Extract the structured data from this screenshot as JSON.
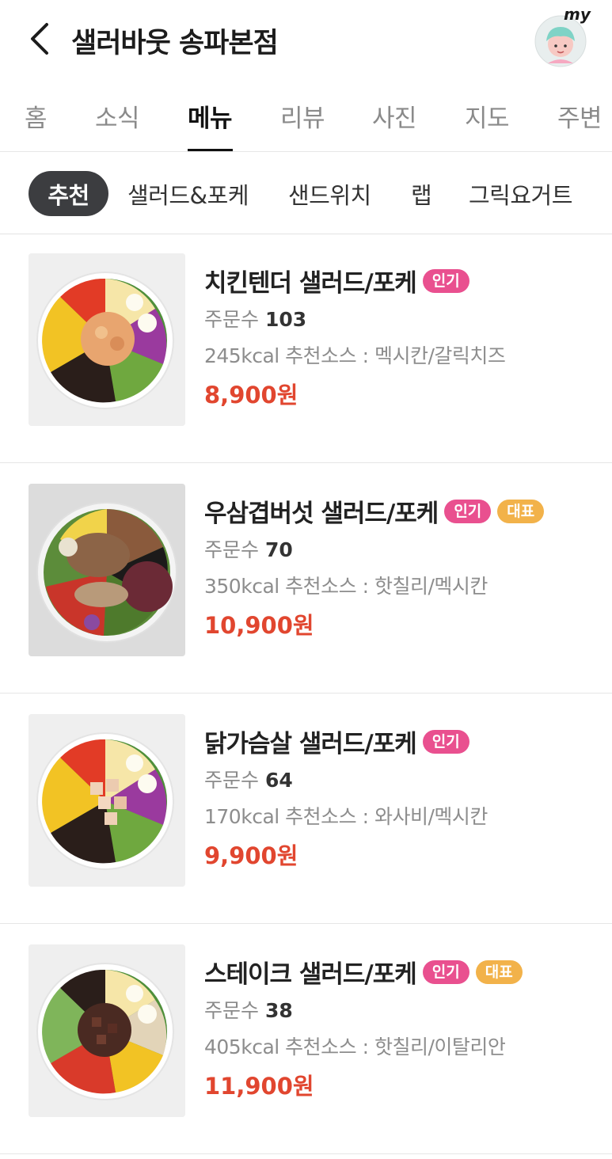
{
  "header": {
    "title": "샐러바웃 송파본점",
    "my_label": "my"
  },
  "tabs": [
    {
      "label": "홈"
    },
    {
      "label": "소식"
    },
    {
      "label": "메뉴",
      "active": true
    },
    {
      "label": "리뷰"
    },
    {
      "label": "사진"
    },
    {
      "label": "지도"
    },
    {
      "label": "주변"
    }
  ],
  "categories": [
    {
      "label": "추천",
      "active": true
    },
    {
      "label": "샐러드&포케"
    },
    {
      "label": "샌드위치"
    },
    {
      "label": "랩"
    },
    {
      "label": "그릭요거트"
    }
  ],
  "menu_items": [
    {
      "name": "치킨텐더 샐러드/포케",
      "badges": [
        "인기"
      ],
      "orders_label": "주문수",
      "orders": "103",
      "description": "245kcal 추천소스 : 멕시칸/갈릭치즈",
      "price": "8,900원"
    },
    {
      "name": "우삼겹버섯 샐러드/포케",
      "badges": [
        "인기",
        "대표"
      ],
      "orders_label": "주문수",
      "orders": "70",
      "description": "350kcal 추천소스 : 핫칠리/멕시칸",
      "price": "10,900원"
    },
    {
      "name": "닭가슴살 샐러드/포케",
      "badges": [
        "인기"
      ],
      "orders_label": "주문수",
      "orders": "64",
      "description": "170kcal 추천소스 : 와사비/멕시칸",
      "price": "9,900원"
    },
    {
      "name": "스테이크 샐러드/포케",
      "badges": [
        "인기",
        "대표"
      ],
      "orders_label": "주문수",
      "orders": "38",
      "description": "405kcal 추천소스 : 핫칠리/이탈리안",
      "price": "11,900원"
    }
  ],
  "colors": {
    "badge_popular": "#e9508f",
    "badge_signature": "#f2b24a",
    "price": "#e1462f",
    "active_category_bg": "#3c3d40"
  }
}
